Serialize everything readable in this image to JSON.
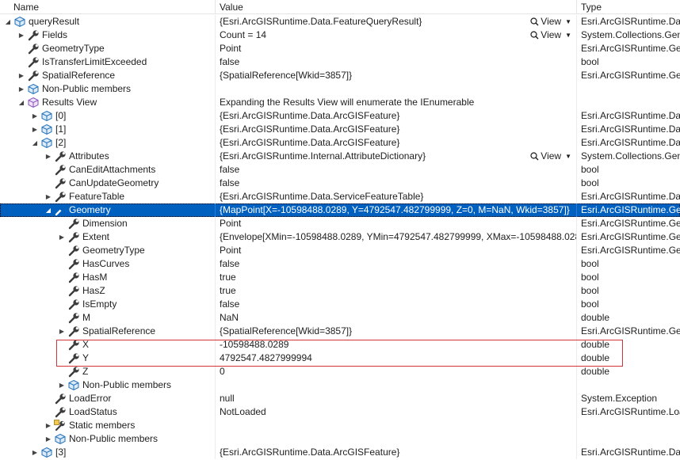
{
  "header": {
    "name": "Name",
    "value": "Value",
    "type": "Type"
  },
  "view_button_label": "View",
  "rows": [
    {
      "depth": 0,
      "expander": "expanded",
      "icon": "object",
      "name": "queryResult",
      "value": "{Esri.ArcGISRuntime.Data.FeatureQueryResult}",
      "type": "Esri.ArcGISRuntime.Data",
      "view": true
    },
    {
      "depth": 1,
      "expander": "collapsed",
      "icon": "wrench",
      "name": "Fields",
      "value": "Count = 14",
      "type": "System.Collections.Gene",
      "view": true
    },
    {
      "depth": 1,
      "expander": "none",
      "icon": "wrench",
      "name": "GeometryType",
      "value": "Point",
      "type": "Esri.ArcGISRuntime.Geo",
      "view": false
    },
    {
      "depth": 1,
      "expander": "none",
      "icon": "wrench",
      "name": "IsTransferLimitExceeded",
      "value": "false",
      "type": "bool",
      "view": false
    },
    {
      "depth": 1,
      "expander": "collapsed",
      "icon": "wrench",
      "name": "SpatialReference",
      "value": "{SpatialReference[Wkid=3857]}",
      "type": "Esri.ArcGISRuntime.Geo",
      "view": false
    },
    {
      "depth": 1,
      "expander": "collapsed",
      "icon": "object",
      "name": "Non-Public members",
      "value": "",
      "type": "",
      "view": false
    },
    {
      "depth": 1,
      "expander": "expanded",
      "icon": "results",
      "name": "Results View",
      "value": "Expanding the Results View will enumerate the IEnumerable",
      "type": "",
      "view": false
    },
    {
      "depth": 2,
      "expander": "collapsed",
      "icon": "object",
      "name": "[0]",
      "value": "{Esri.ArcGISRuntime.Data.ArcGISFeature}",
      "type": "Esri.ArcGISRuntime.Data",
      "view": false
    },
    {
      "depth": 2,
      "expander": "collapsed",
      "icon": "object",
      "name": "[1]",
      "value": "{Esri.ArcGISRuntime.Data.ArcGISFeature}",
      "type": "Esri.ArcGISRuntime.Data",
      "view": false
    },
    {
      "depth": 2,
      "expander": "expanded",
      "icon": "object",
      "name": "[2]",
      "value": "{Esri.ArcGISRuntime.Data.ArcGISFeature}",
      "type": "Esri.ArcGISRuntime.Data",
      "view": false
    },
    {
      "depth": 3,
      "expander": "collapsed",
      "icon": "wrench",
      "name": "Attributes",
      "value": "{Esri.ArcGISRuntime.Internal.AttributeDictionary}",
      "type": "System.Collections.Gene",
      "view": true
    },
    {
      "depth": 3,
      "expander": "none",
      "icon": "wrench",
      "name": "CanEditAttachments",
      "value": "false",
      "type": "bool",
      "view": false
    },
    {
      "depth": 3,
      "expander": "none",
      "icon": "wrench",
      "name": "CanUpdateGeometry",
      "value": "false",
      "type": "bool",
      "view": false
    },
    {
      "depth": 3,
      "expander": "collapsed",
      "icon": "wrench",
      "name": "FeatureTable",
      "value": "{Esri.ArcGISRuntime.Data.ServiceFeatureTable}",
      "type": "Esri.ArcGISRuntime.Data",
      "view": false
    },
    {
      "depth": 3,
      "expander": "expanded",
      "icon": "wrench",
      "name": "Geometry",
      "value": "{MapPoint[X=-10598488.0289, Y=4792547.482799999, Z=0, M=NaN, Wkid=3857]}",
      "type": "Esri.ArcGISRuntime.Geo",
      "view": false,
      "selected": true
    },
    {
      "depth": 4,
      "expander": "none",
      "icon": "wrench",
      "name": "Dimension",
      "value": "Point",
      "type": "Esri.ArcGISRuntime.Geo",
      "view": false
    },
    {
      "depth": 4,
      "expander": "collapsed",
      "icon": "wrench",
      "name": "Extent",
      "value": "{Envelope[XMin=-10598488.0289, YMin=4792547.482799999, XMax=-10598488.0289,...",
      "type": "Esri.ArcGISRuntime.Geo",
      "view": false
    },
    {
      "depth": 4,
      "expander": "none",
      "icon": "wrench",
      "name": "GeometryType",
      "value": "Point",
      "type": "Esri.ArcGISRuntime.Geo",
      "view": false
    },
    {
      "depth": 4,
      "expander": "none",
      "icon": "wrench",
      "name": "HasCurves",
      "value": "false",
      "type": "bool",
      "view": false
    },
    {
      "depth": 4,
      "expander": "none",
      "icon": "wrench",
      "name": "HasM",
      "value": "true",
      "type": "bool",
      "view": false
    },
    {
      "depth": 4,
      "expander": "none",
      "icon": "wrench",
      "name": "HasZ",
      "value": "true",
      "type": "bool",
      "view": false
    },
    {
      "depth": 4,
      "expander": "none",
      "icon": "wrench",
      "name": "IsEmpty",
      "value": "false",
      "type": "bool",
      "view": false
    },
    {
      "depth": 4,
      "expander": "none",
      "icon": "wrench",
      "name": "M",
      "value": "NaN",
      "type": "double",
      "view": false
    },
    {
      "depth": 4,
      "expander": "collapsed",
      "icon": "wrench",
      "name": "SpatialReference",
      "value": "{SpatialReference[Wkid=3857]}",
      "type": "Esri.ArcGISRuntime.Geo",
      "view": false
    },
    {
      "depth": 4,
      "expander": "none",
      "icon": "wrench",
      "name": "X",
      "value": "-10598488.0289",
      "type": "double",
      "view": false
    },
    {
      "depth": 4,
      "expander": "none",
      "icon": "wrench",
      "name": "Y",
      "value": "4792547.4827999994",
      "type": "double",
      "view": false
    },
    {
      "depth": 4,
      "expander": "none",
      "icon": "wrench",
      "name": "Z",
      "value": "0",
      "type": "double",
      "view": false
    },
    {
      "depth": 4,
      "expander": "collapsed",
      "icon": "object",
      "name": "Non-Public members",
      "value": "",
      "type": "",
      "view": false
    },
    {
      "depth": 3,
      "expander": "none",
      "icon": "wrench",
      "name": "LoadError",
      "value": "null",
      "type": "System.Exception",
      "view": false
    },
    {
      "depth": 3,
      "expander": "none",
      "icon": "wrench",
      "name": "LoadStatus",
      "value": "NotLoaded",
      "type": "Esri.ArcGISRuntime.Load",
      "view": false
    },
    {
      "depth": 3,
      "expander": "collapsed",
      "icon": "static",
      "name": "Static members",
      "value": "",
      "type": "",
      "view": false
    },
    {
      "depth": 3,
      "expander": "collapsed",
      "icon": "object",
      "name": "Non-Public members",
      "value": "",
      "type": "",
      "view": false
    },
    {
      "depth": 2,
      "expander": "collapsed",
      "icon": "object",
      "name": "[3]",
      "value": "{Esri.ArcGISRuntime.Data.ArcGISFeature}",
      "type": "Esri.ArcGISRuntime.Data",
      "view": false
    }
  ]
}
